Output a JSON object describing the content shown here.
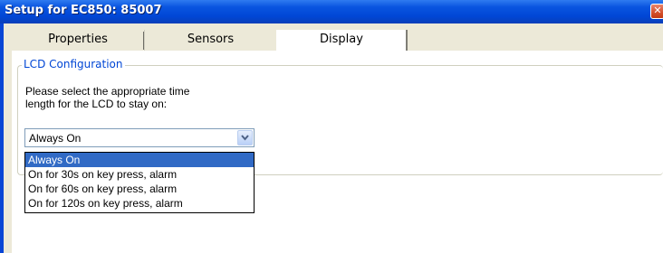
{
  "window": {
    "title": "Setup for EC850: 85007",
    "close_glyph": "✕"
  },
  "tabs": [
    {
      "label": "Properties",
      "active": false
    },
    {
      "label": "Sensors",
      "active": false
    },
    {
      "label": "Display",
      "active": true
    }
  ],
  "lcd_group": {
    "legend": "LCD Configuration",
    "prompt_line1": "Please select the appropriate time",
    "prompt_line2": "length for the LCD to stay on:"
  },
  "lcd_select": {
    "value": "Always On",
    "options": [
      "Always On",
      "On for 30s on key press, alarm",
      "On for 60s on key press, alarm",
      "On for 120s on key press, alarm"
    ],
    "highlighted_index": 0
  },
  "colors": {
    "titlebar": "#0046d5",
    "group_legend": "#0046d5",
    "selection": "#316ac5"
  },
  "icons": {
    "close": "close-icon",
    "dropdown": "chevron-down-icon"
  }
}
